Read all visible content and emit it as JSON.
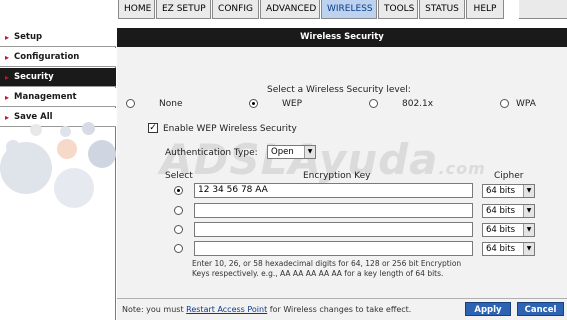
{
  "nav": {
    "tabs": [
      {
        "label": "HOME",
        "active": false
      },
      {
        "label": "EZ SETUP",
        "active": false
      },
      {
        "label": "CONFIG",
        "active": false
      },
      {
        "label": "ADVANCED",
        "active": false
      },
      {
        "label": "WIRELESS",
        "active": true
      },
      {
        "label": "TOOLS",
        "active": false
      },
      {
        "label": "STATUS",
        "active": false
      },
      {
        "label": "HELP",
        "active": false
      }
    ]
  },
  "sidebar": {
    "items": [
      {
        "label": "Setup",
        "active": false
      },
      {
        "label": "Configuration",
        "active": false
      },
      {
        "label": "Security",
        "active": true
      },
      {
        "label": "Management",
        "active": false
      },
      {
        "label": "Save All",
        "active": false
      }
    ]
  },
  "panel": {
    "title": "Wireless Security",
    "level_prompt": "Select a Wireless Security level:",
    "levels": [
      {
        "label": "None",
        "selected": false
      },
      {
        "label": "WEP",
        "selected": true
      },
      {
        "label": "802.1x",
        "selected": false
      },
      {
        "label": "WPA",
        "selected": false
      }
    ],
    "enable_wep_label": "Enable WEP Wireless Security",
    "enable_wep_checked": true,
    "auth_type_label": "Authentication Type:",
    "auth_type_value": "Open",
    "col_select": "Select",
    "col_key": "Encryption Key",
    "col_cipher": "Cipher",
    "keys": [
      {
        "selected": true,
        "value": "12 34 56 78 AA",
        "cipher": "64 bits"
      },
      {
        "selected": false,
        "value": "",
        "cipher": "64 bits"
      },
      {
        "selected": false,
        "value": "",
        "cipher": "64 bits"
      },
      {
        "selected": false,
        "value": "",
        "cipher": "64 bits"
      }
    ],
    "hint": "Enter 10, 26, or 58 hexadecimal digits for 64, 128 or 256 bit Encryption Keys respectively. e.g., AA AA AA AA AA for a key length of 64 bits."
  },
  "watermark": {
    "main": "ADSLAyuda",
    "suffix": ".com"
  },
  "footer": {
    "note_before": "Note: you must ",
    "note_link": "Restart Access Point",
    "note_after": " for Wireless changes to take effect.",
    "apply_label": "Apply",
    "cancel_label": "Cancel"
  },
  "colors": {
    "accent": "#2d63b3",
    "active_tab": "#bcd2ee",
    "sidebar_active": "#1a1a1a",
    "arrow": "#c8102e"
  }
}
